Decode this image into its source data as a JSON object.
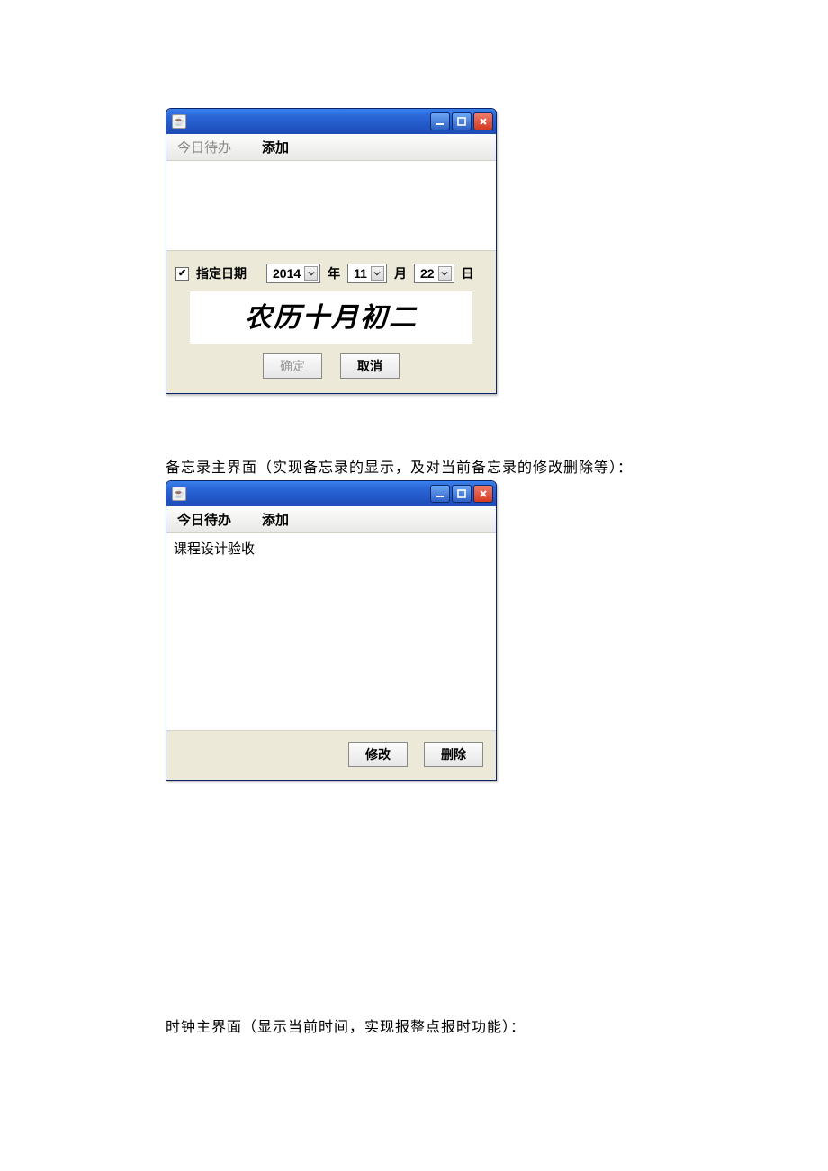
{
  "window1": {
    "menu": {
      "today": "今日待办",
      "add": "添加"
    },
    "dateRow": {
      "checkboxLabel": "指定日期",
      "year": "2014",
      "yearLabel": "年",
      "month": "11",
      "monthLabel": "月",
      "day": "22",
      "dayLabel": "日"
    },
    "lunar": "农历十月初二",
    "buttons": {
      "ok": "确定",
      "cancel": "取消"
    }
  },
  "caption1": "备忘录主界面（实现备忘录的显示，及对当前备忘录的修改删除等）：",
  "window2": {
    "menu": {
      "today": "今日待办",
      "add": "添加"
    },
    "listItem": "课程设计验收",
    "buttons": {
      "edit": "修改",
      "delete": "删除"
    }
  },
  "caption2": "时钟主界面（显示当前时间，实现报整点报时功能）："
}
